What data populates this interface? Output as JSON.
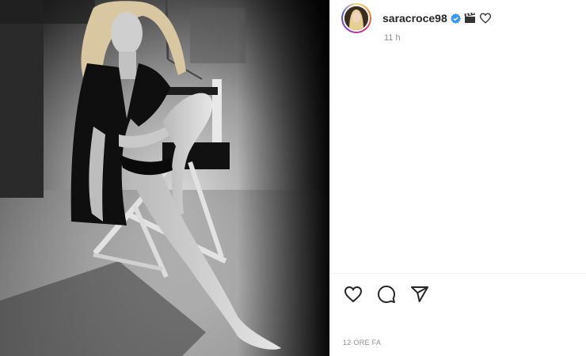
{
  "post": {
    "photo": {
      "alt_icon": "photo-image",
      "tone": "black-and-white"
    },
    "header": {
      "username": "saracroce98",
      "verified_icon": "verified-badge-icon",
      "emoji_icons": [
        "clapper-board-icon",
        "heart-outline-icon"
      ],
      "time_ago": "11 h"
    },
    "actions": {
      "like_icon": "heart-icon",
      "comment_icon": "comment-icon",
      "share_icon": "send-icon"
    },
    "date_label": "12 ORE FA"
  },
  "colors": {
    "text": "#262626",
    "muted": "#8e8e8e",
    "verified": "#3897f0",
    "divider": "#efefef"
  }
}
